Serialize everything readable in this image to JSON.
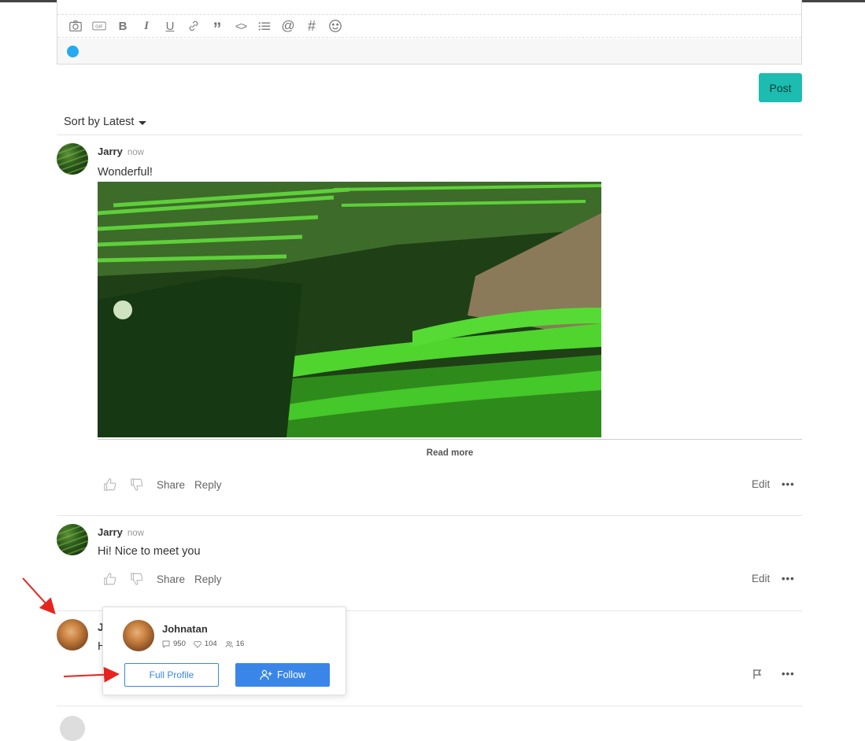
{
  "composer": {
    "toolbar": [
      {
        "name": "camera-icon",
        "glyph": ""
      },
      {
        "name": "gif-icon",
        "glyph": ""
      },
      {
        "name": "bold-icon",
        "glyph": "B"
      },
      {
        "name": "italic-icon",
        "glyph": "I"
      },
      {
        "name": "underline-icon",
        "glyph": "U"
      },
      {
        "name": "link-icon",
        "glyph": ""
      },
      {
        "name": "quote-icon",
        "glyph": "”"
      },
      {
        "name": "code-icon",
        "glyph": "<>"
      },
      {
        "name": "list-icon",
        "glyph": ""
      },
      {
        "name": "mention-icon",
        "glyph": "@"
      },
      {
        "name": "hashtag-icon",
        "glyph": "#"
      },
      {
        "name": "emoji-icon",
        "glyph": ""
      }
    ],
    "gif_label": "GIF",
    "post_label": "Post",
    "accent": "#1cbcb0"
  },
  "sort": {
    "label": "Sort by Latest"
  },
  "comments": [
    {
      "author": "Jarry",
      "time": "now",
      "text": "Wonderful!",
      "read_more": "Read more",
      "share": "Share",
      "reply": "Reply",
      "edit": "Edit",
      "more": "•••"
    },
    {
      "author": "Jarry",
      "time": "now",
      "text": "Hi! Nice to meet you",
      "share": "Share",
      "reply": "Reply",
      "edit": "Edit",
      "more": "•••"
    },
    {
      "author_initial": "J",
      "text_initial": "H",
      "more": "•••"
    }
  ],
  "popover": {
    "name": "Johnatan",
    "stats": {
      "comments": "950",
      "likes": "104",
      "followers": "16"
    },
    "full_profile": "Full Profile",
    "follow": "Follow",
    "button_color": "#3a86e8"
  }
}
